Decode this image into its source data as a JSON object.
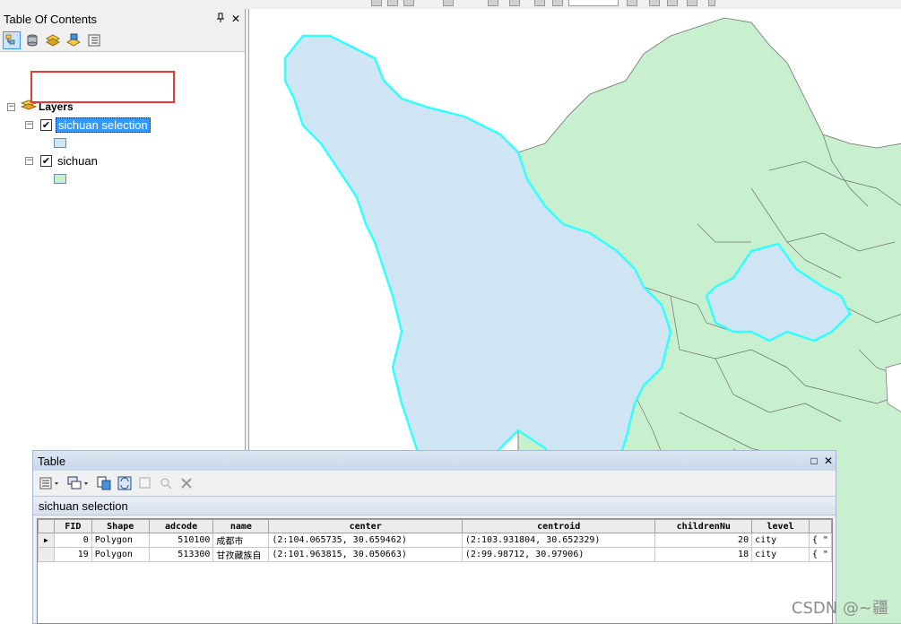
{
  "toc": {
    "title": "Table Of Contents",
    "pin_icon": "pin-icon",
    "close_symbol": "✕",
    "toolbar_icons": [
      "list-by-drawing-order-icon",
      "list-by-source-icon",
      "list-by-visibility-icon",
      "list-by-selection-icon",
      "options-icon"
    ],
    "root_label": "Layers",
    "layers": [
      {
        "label": "sichuan selection",
        "checked": true,
        "selected": true,
        "swatch_color": "#cfe5f3"
      },
      {
        "label": "sichuan",
        "checked": true,
        "selected": false,
        "swatch_color": "#c8f0cf"
      }
    ]
  },
  "map": {
    "selection_fill": "#cfe5f3",
    "selection_outline": "#33ffff",
    "base_fill": "#c8f0cf",
    "base_outline": "#606060"
  },
  "table": {
    "title": "Table",
    "restore_symbol": "□",
    "close_symbol": "✕",
    "tab_label": "sichuan selection",
    "columns": [
      "FID",
      "Shape",
      "adcode",
      "name",
      "center",
      "centroid",
      "childrenNu",
      "level",
      ""
    ],
    "rows": [
      {
        "marker": "▶",
        "FID": "0",
        "Shape": "Polygon",
        "adcode": "510100",
        "name": "成都市",
        "center": "(2:104.065735, 30.659462)",
        "centroid": "(2:103.931804, 30.652329)",
        "childrenNu": "20",
        "level": "city",
        "extra": "{ \""
      },
      {
        "marker": "",
        "FID": "19",
        "Shape": "Polygon",
        "adcode": "513300",
        "name": "甘孜藏族自",
        "center": "(2:101.963815, 30.050663)",
        "centroid": "(2:99.98712, 30.97906)",
        "childrenNu": "18",
        "level": "city",
        "extra": "{ \""
      }
    ]
  },
  "watermark": "CSDN @~疆"
}
